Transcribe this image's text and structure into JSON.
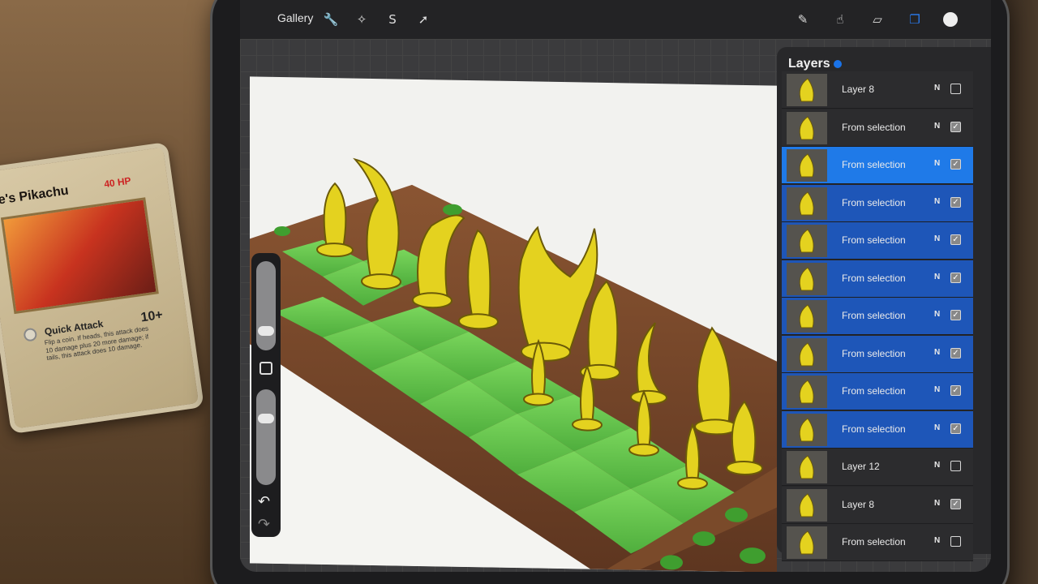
{
  "card": {
    "title": "e's Pikachu",
    "hp": "40 HP",
    "attack": "Quick Attack",
    "damage": "10+",
    "text": "Flip a coin. If heads, this attack does 10 damage plus 20 more damage; if tails, this attack does 10 damage."
  },
  "toolbar": {
    "gallery_label": "Gallery",
    "left_icons": [
      "wrench-icon",
      "magic-wand-icon",
      "selection-s-icon",
      "transform-arrow-icon"
    ],
    "right_icons": [
      "brush-icon",
      "smudge-icon",
      "eraser-icon",
      "layers-icon",
      "color-circle-icon"
    ]
  },
  "layers_panel": {
    "title": "Layers",
    "layers": [
      {
        "name": "Layer 8",
        "mode": "N",
        "visible": false,
        "selected": false
      },
      {
        "name": "From selection",
        "mode": "N",
        "visible": true,
        "selected": false
      },
      {
        "name": "From selection",
        "mode": "N",
        "visible": true,
        "selected": true,
        "primary": true
      },
      {
        "name": "From selection",
        "mode": "N",
        "visible": true,
        "selected": true
      },
      {
        "name": "From selection",
        "mode": "N",
        "visible": true,
        "selected": true
      },
      {
        "name": "From selection",
        "mode": "N",
        "visible": true,
        "selected": true
      },
      {
        "name": "From selection",
        "mode": "N",
        "visible": true,
        "selected": true
      },
      {
        "name": "From selection",
        "mode": "N",
        "visible": true,
        "selected": true
      },
      {
        "name": "From selection",
        "mode": "N",
        "visible": true,
        "selected": true
      },
      {
        "name": "From selection",
        "mode": "N",
        "visible": true,
        "selected": true
      },
      {
        "name": "Layer 12",
        "mode": "N",
        "visible": false,
        "selected": false
      },
      {
        "name": "Layer 8",
        "mode": "N",
        "visible": true,
        "selected": false
      },
      {
        "name": "From selection",
        "mode": "N",
        "visible": false,
        "selected": false
      }
    ]
  },
  "colors": {
    "accent": "#1f7ae8",
    "selected_row": "#1e56b8",
    "board_green": "#5fc24a",
    "board_brown": "#7a4a2a",
    "piece_yellow": "#e4d21f"
  }
}
